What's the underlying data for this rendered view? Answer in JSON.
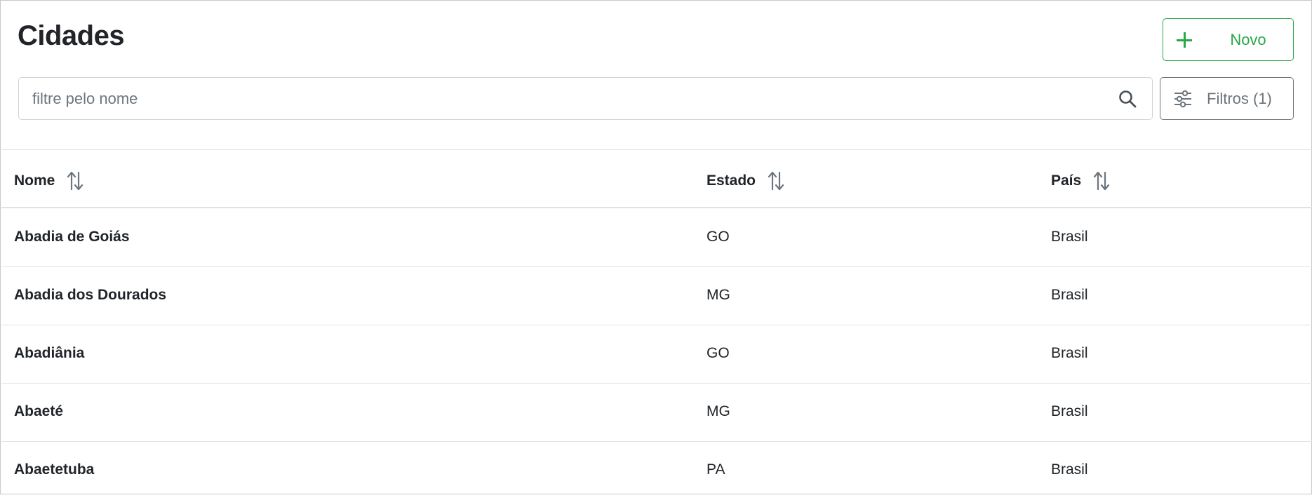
{
  "page": {
    "title": "Cidades",
    "new_button_label": "Novo",
    "filters_button_label": "Filtros (1)"
  },
  "search": {
    "placeholder": "filtre pelo nome",
    "value": ""
  },
  "table": {
    "columns": [
      "Nome",
      "Estado",
      "País"
    ],
    "rows": [
      {
        "nome": "Abadia de Goiás",
        "estado": "GO",
        "pais": "Brasil"
      },
      {
        "nome": "Abadia dos Dourados",
        "estado": "MG",
        "pais": "Brasil"
      },
      {
        "nome": "Abadiânia",
        "estado": "GO",
        "pais": "Brasil"
      },
      {
        "nome": "Abaeté",
        "estado": "MG",
        "pais": "Brasil"
      },
      {
        "nome": "Abaetetuba",
        "estado": "PA",
        "pais": "Brasil"
      }
    ]
  },
  "icons": {
    "new": "plus-icon",
    "search": "search-icon",
    "filters": "sliders-icon",
    "sort": "sort-arrows-icon"
  },
  "colors": {
    "primary_green": "#28a745",
    "secondary_gray": "#6c757d",
    "border": "#dee2e6",
    "text": "#212529"
  }
}
